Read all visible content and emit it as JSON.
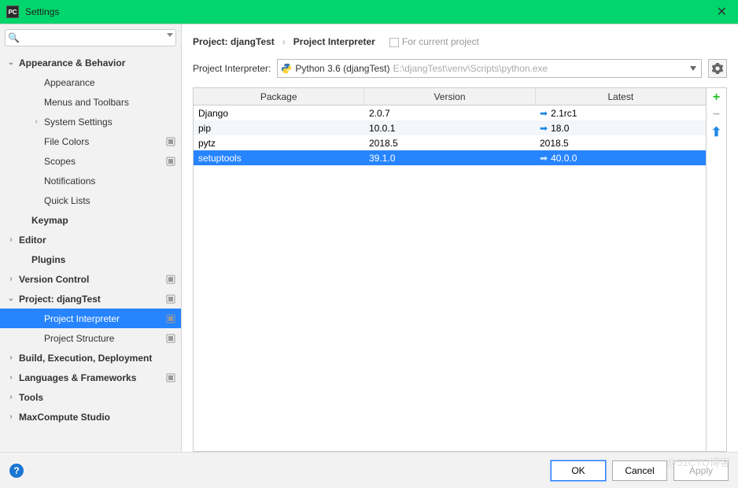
{
  "window": {
    "title": "Settings"
  },
  "sidebar": {
    "search_placeholder": "",
    "items": [
      {
        "label": "Appearance & Behavior",
        "expanded": true,
        "bold": true,
        "depth": 0
      },
      {
        "label": "Appearance",
        "depth": 1
      },
      {
        "label": "Menus and Toolbars",
        "depth": 1
      },
      {
        "label": "System Settings",
        "depth": 1,
        "hasChildren": true
      },
      {
        "label": "File Colors",
        "depth": 1,
        "badge": true
      },
      {
        "label": "Scopes",
        "depth": 1,
        "badge": true
      },
      {
        "label": "Notifications",
        "depth": 1
      },
      {
        "label": "Quick Lists",
        "depth": 1
      },
      {
        "label": "Keymap",
        "bold": true,
        "depth": 0
      },
      {
        "label": "Editor",
        "bold": true,
        "depth": 0,
        "hasChildren": true
      },
      {
        "label": "Plugins",
        "bold": true,
        "depth": 0
      },
      {
        "label": "Version Control",
        "bold": true,
        "depth": 0,
        "hasChildren": true,
        "badge": true
      },
      {
        "label": "Project: djangTest",
        "bold": true,
        "depth": 0,
        "expanded": true,
        "badge": true
      },
      {
        "label": "Project Interpreter",
        "depth": 1,
        "selected": true,
        "badge": true
      },
      {
        "label": "Project Structure",
        "depth": 1,
        "badge": true
      },
      {
        "label": "Build, Execution, Deployment",
        "bold": true,
        "depth": 0,
        "hasChildren": true
      },
      {
        "label": "Languages & Frameworks",
        "bold": true,
        "depth": 0,
        "hasChildren": true,
        "badge": true
      },
      {
        "label": "Tools",
        "bold": true,
        "depth": 0,
        "hasChildren": true
      },
      {
        "label": "MaxCompute Studio",
        "bold": true,
        "depth": 0,
        "hasChildren": true
      }
    ]
  },
  "breadcrumb": {
    "root": "Project: djangTest",
    "leaf": "Project Interpreter",
    "tag": "For current project"
  },
  "interpreter": {
    "label": "Project Interpreter:",
    "name": "Python 3.6 (djangTest)",
    "path": "E:\\djangTest\\venv\\Scripts\\python.exe"
  },
  "table": {
    "headers": [
      "Package",
      "Version",
      "Latest"
    ],
    "rows": [
      {
        "pkg": "Django",
        "version": "2.0.7",
        "latest": "2.1rc1",
        "upgrade": true
      },
      {
        "pkg": "pip",
        "version": "10.0.1",
        "latest": "18.0",
        "upgrade": true
      },
      {
        "pkg": "pytz",
        "version": "2018.5",
        "latest": "2018.5",
        "upgrade": false
      },
      {
        "pkg": "setuptools",
        "version": "39.1.0",
        "latest": "40.0.0",
        "upgrade": true,
        "selected": true
      }
    ]
  },
  "footer": {
    "ok": "OK",
    "cancel": "Cancel",
    "apply": "Apply"
  },
  "watermark": "@51CTO博客"
}
